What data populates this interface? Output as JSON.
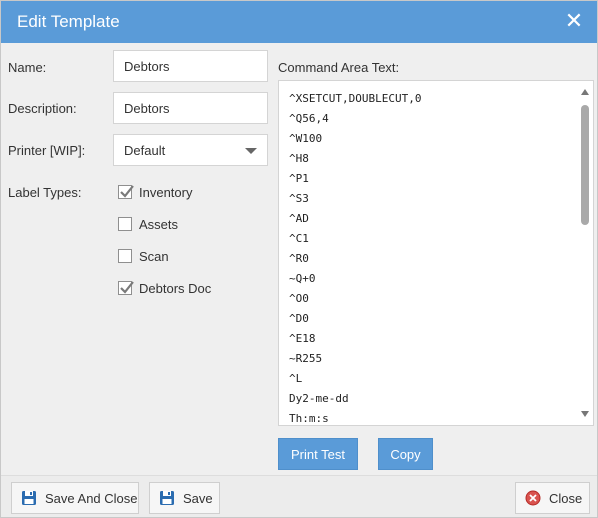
{
  "dialog": {
    "title": "Edit Template",
    "close_icon": "close-icon"
  },
  "form": {
    "name_label": "Name:",
    "name_value": "Debtors",
    "description_label": "Description:",
    "description_value": "Debtors",
    "printer_label": "Printer [WIP]:",
    "printer_value": "Default",
    "label_types_label": "Label Types:",
    "label_types": [
      {
        "label": "Inventory",
        "checked": true
      },
      {
        "label": "Assets",
        "checked": false
      },
      {
        "label": "Scan",
        "checked": false
      },
      {
        "label": "Debtors Doc",
        "checked": true
      }
    ]
  },
  "command": {
    "label": "Command Area Text:",
    "lines": [
      "^XSETCUT,DOUBLECUT,0",
      "^Q56,4",
      "^W100",
      "^H8",
      "^P1",
      "^S3",
      "^AD",
      "^C1",
      "^R0",
      "~Q+0",
      "^O0",
      "^D0",
      "^E18",
      "~R255",
      "^L",
      "Dy2-me-dd",
      "Th:m:s"
    ]
  },
  "actions": {
    "print_test_label": "Print Test",
    "copy_label": "Copy"
  },
  "footer": {
    "save_and_close_label": "Save And Close",
    "save_label": "Save",
    "close_label": "Close"
  },
  "colors": {
    "accent": "#5a9bd8",
    "close_red": "#d9534f",
    "save_icon_blue": "#2b6cb0"
  }
}
